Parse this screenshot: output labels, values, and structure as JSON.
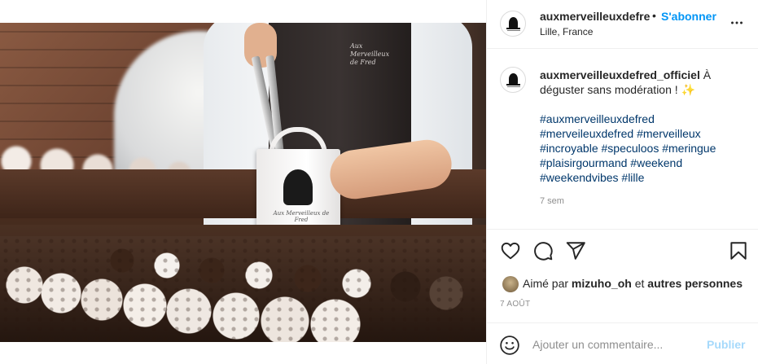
{
  "post": {
    "username": "auxmerveilleuxdefre",
    "separator": "•",
    "follow_label": "S'abonner",
    "location": "Lille, France",
    "photo": {
      "apron_text": "Aux Merveilleux de Fred",
      "box_text": "Aux Merveilleux de Fred"
    }
  },
  "caption": {
    "username": "auxmerveilleuxdefred_officiel",
    "text": " À déguster sans modération ! ✨",
    "hashtags": [
      "#auxmerveilleuxdefred",
      "#merveileuxdefred",
      "#merveilleux",
      "#incroyable",
      "#speculoos",
      "#meringue",
      "#plaisirgourmand",
      "#weekend",
      "#weekendvibes",
      "#lille"
    ],
    "time_ago": "7 sem"
  },
  "likes": {
    "prefix": "Aimé par ",
    "user": "mizuho_oh",
    "middle": " et ",
    "others": "autres personnes"
  },
  "date": "7 AOÛT",
  "comment": {
    "placeholder": "Ajouter un commentaire...",
    "post_label": "Publier"
  },
  "icons": {
    "more": "more-horizontal-icon",
    "like": "heart-icon",
    "comment": "speech-bubble-icon",
    "share": "paper-plane-icon",
    "save": "bookmark-icon",
    "emoji": "smiley-icon"
  },
  "colors": {
    "link_blue": "#0095f6",
    "hashtag_blue": "#00376b",
    "muted_gray": "#8e8e8e",
    "text": "#262626",
    "divider": "#efefef"
  }
}
